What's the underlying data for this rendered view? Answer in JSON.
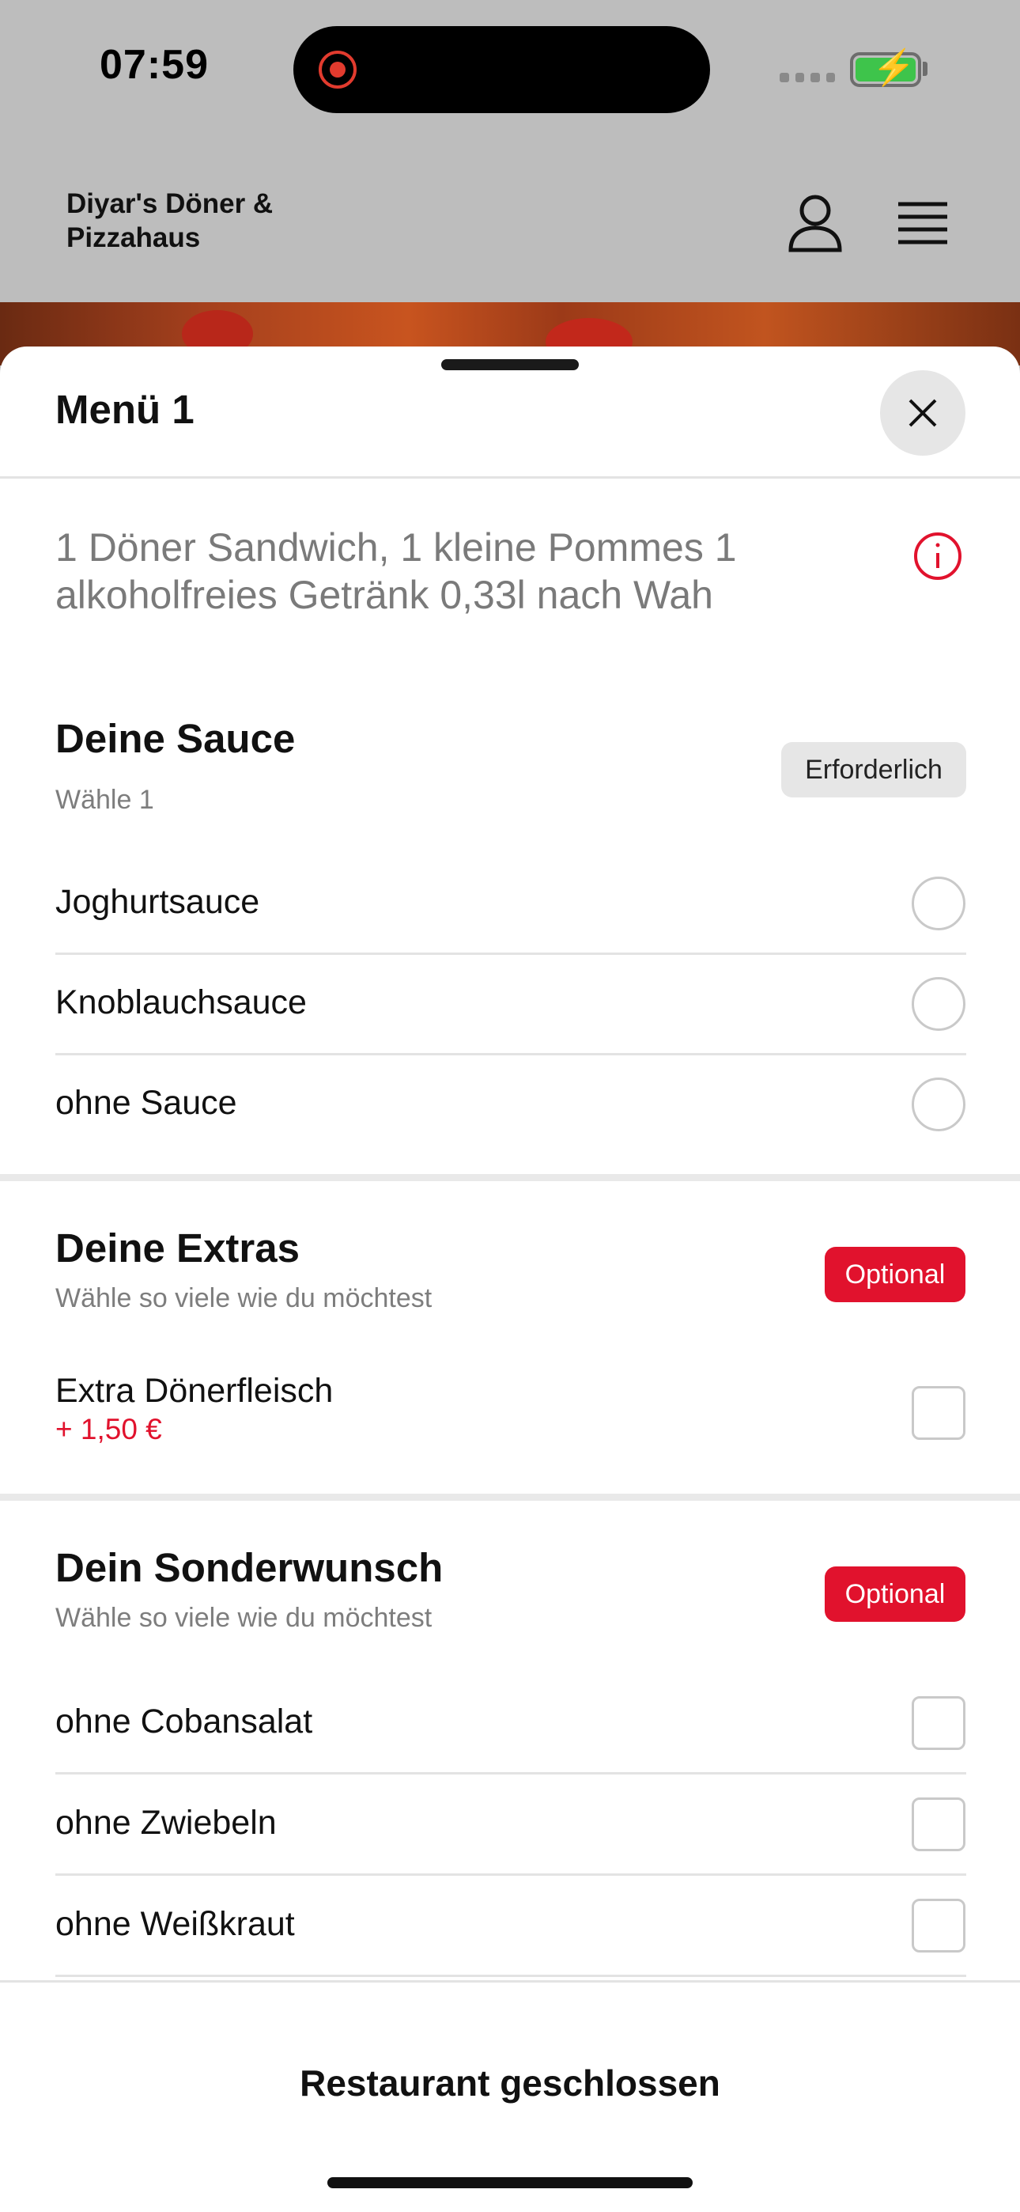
{
  "status_bar": {
    "time": "07:59",
    "battery_state": "charging"
  },
  "header": {
    "restaurant_name": "Diyar's Döner & Pizzahaus",
    "profile_icon": "user-icon",
    "menu_icon": "hamburger-menu-icon"
  },
  "sheet": {
    "title": "Menü 1",
    "description": "1 Döner Sandwich, 1 kleine Pommes 1 alkoholfreies Getränk 0,33l nach Wah",
    "groups": [
      {
        "title": "Deine Sauce",
        "subtitle": "Wähle 1",
        "badge": "Erforderlich",
        "type": "radio",
        "options": [
          {
            "label": "Joghurtsauce",
            "selected": false
          },
          {
            "label": "Knoblauchsauce",
            "selected": false
          },
          {
            "label": "ohne Sauce",
            "selected": false
          }
        ]
      },
      {
        "title": "Deine Extras",
        "subtitle": "Wähle so viele wie du möchtest",
        "badge": "Optional",
        "type": "checkbox",
        "options": [
          {
            "label": "Extra Dönerfleisch",
            "price": "+ 1,50 €",
            "checked": false
          }
        ]
      },
      {
        "title": "Dein Sonderwunsch",
        "subtitle": "Wähle so viele wie du möchtest",
        "badge": "Optional",
        "type": "checkbox",
        "options": [
          {
            "label": "ohne Cobansalat",
            "checked": false
          },
          {
            "label": "ohne Zwiebeln",
            "checked": false
          },
          {
            "label": "ohne Weißkraut",
            "checked": false
          }
        ]
      }
    ],
    "footer_label": "Restaurant geschlossen"
  },
  "colors": {
    "accent": "#e1122d",
    "overlay": "#bdbdbd",
    "badge_neutral": "#e6e6e6"
  }
}
